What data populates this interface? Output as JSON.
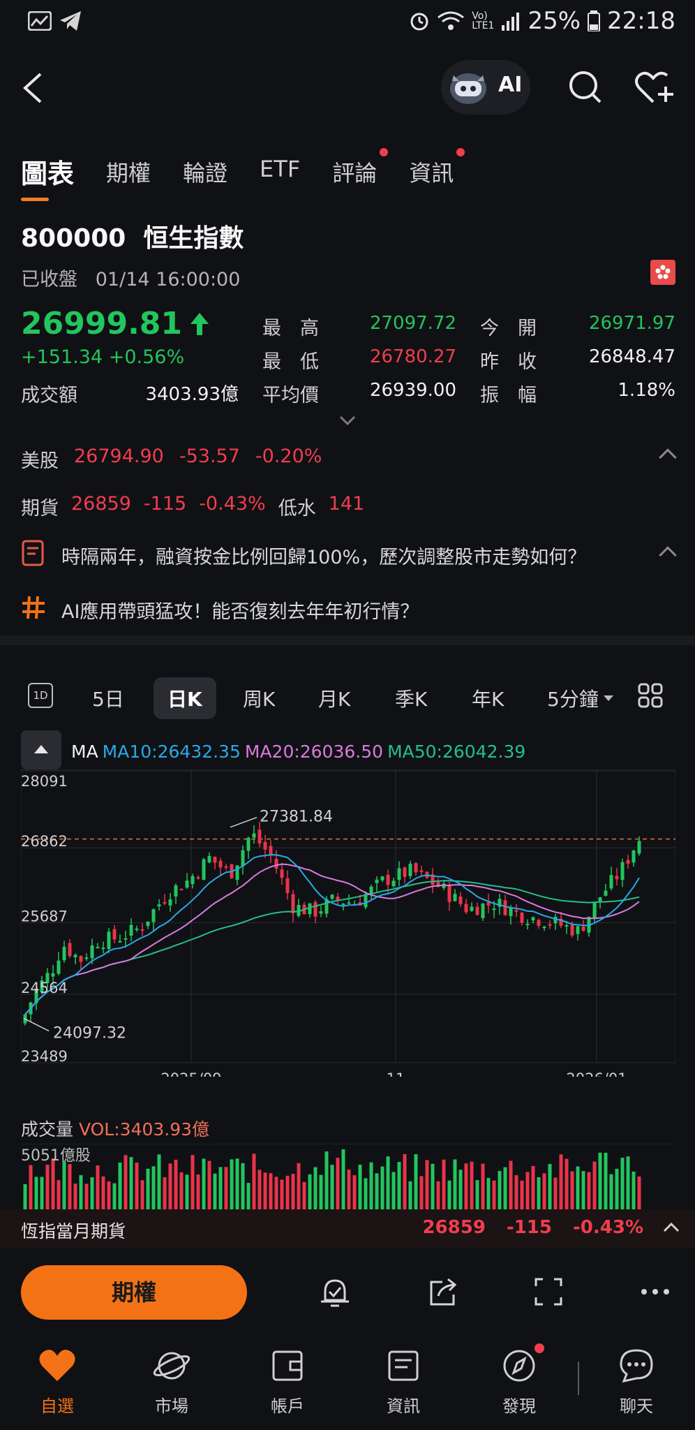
{
  "status_bar": {
    "battery": "25%",
    "time": "22:18"
  },
  "header": {
    "ai_label": "AI"
  },
  "tabs": [
    {
      "label": "圖表",
      "active": true,
      "dot": false
    },
    {
      "label": "期權",
      "active": false,
      "dot": false
    },
    {
      "label": "輪證",
      "active": false,
      "dot": false
    },
    {
      "label": "ETF",
      "active": false,
      "dot": false
    },
    {
      "label": "評論",
      "active": false,
      "dot": true
    },
    {
      "label": "資訊",
      "active": false,
      "dot": true
    }
  ],
  "quote": {
    "code": "800000",
    "name": "恒生指數",
    "status": "已收盤",
    "datetime": "01/14 16:00:00",
    "price": "26999.81",
    "change": "+151.34",
    "change_pct": "+0.56%",
    "turnover_label": "成交額",
    "turnover": "3403.93億",
    "high_label": "最　高",
    "high": "27097.72",
    "low_label": "最　低",
    "low": "26780.27",
    "avg_label": "平均價",
    "avg": "26939.00",
    "open_label": "今　開",
    "open": "26971.97",
    "prev_close_label": "昨　收",
    "prev_close": "26848.47",
    "amplitude_label": "振　幅",
    "amplitude": "1.18%"
  },
  "us_stock": {
    "label": "美股",
    "price": "26794.90",
    "change": "-53.57",
    "pct": "-0.20%"
  },
  "futures": {
    "label": "期貨",
    "price": "26859",
    "change": "-115",
    "pct": "-0.43%",
    "discount_label": "低水",
    "discount": "141"
  },
  "news": [
    {
      "text": "時隔兩年，融資按金比例回歸100%，歷次調整股市走勢如何？"
    },
    {
      "text": "AI應用帶頭猛攻！能否復刻去年年初行情？"
    }
  ],
  "periods": [
    {
      "label": "5日",
      "active": false
    },
    {
      "label": "日K",
      "active": true
    },
    {
      "label": "周K",
      "active": false
    },
    {
      "label": "月K",
      "active": false
    },
    {
      "label": "季K",
      "active": false
    },
    {
      "label": "年K",
      "active": false
    },
    {
      "label": "5分鐘",
      "active": false
    }
  ],
  "period_icon_label": "1D",
  "ma": {
    "label": "MA",
    "ma10": "MA10:26432.35",
    "ma20": "MA20:26036.50",
    "ma50": "MA50:26042.39",
    "colors": {
      "ma10": "#2ba8e8",
      "ma20": "#d97ae0",
      "ma50": "#22c089"
    }
  },
  "chart_data": {
    "type": "candlestick",
    "y_ticks": [
      "28091",
      "26862",
      "25687",
      "24564",
      "23489"
    ],
    "x_ticks": [
      "2025/09",
      "11",
      "2026/01"
    ],
    "ylim": [
      23489,
      28091
    ],
    "high_annotation": "27381.84",
    "low_annotation": "24097.32",
    "reference_line": 26999.81,
    "up_color": "#22c55e",
    "down_color": "#e8344a"
  },
  "volume": {
    "title": "成交量",
    "value_label": "VOL:3403.93億",
    "max_label": "5051億股"
  },
  "futures_bar": {
    "label": "恆指當月期貨",
    "price": "26859",
    "change": "-115",
    "pct": "-0.43%"
  },
  "actions": {
    "options_button": "期權"
  },
  "bottom_nav": [
    {
      "label": "自選",
      "icon": "heart-icon",
      "active": true
    },
    {
      "label": "市場",
      "icon": "planet-icon",
      "active": false
    },
    {
      "label": "帳戶",
      "icon": "wallet-icon",
      "active": false
    },
    {
      "label": "資訊",
      "icon": "news-icon",
      "active": false
    },
    {
      "label": "發現",
      "icon": "compass-icon",
      "active": false
    },
    {
      "label": "聊天",
      "icon": "chat-icon",
      "active": false
    }
  ]
}
